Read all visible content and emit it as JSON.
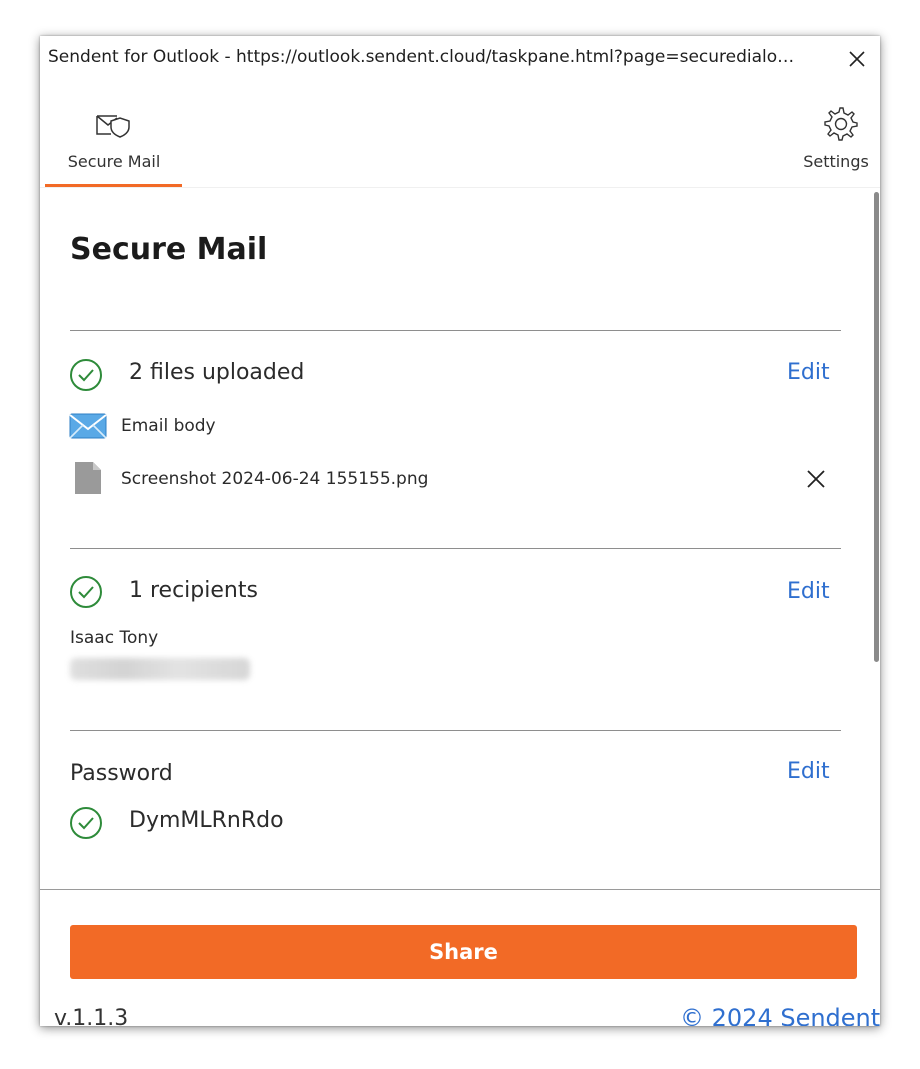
{
  "window": {
    "title": "Sendent for Outlook - https://outlook.sendent.cloud/taskpane.html?page=securedialo…"
  },
  "tabs": {
    "secure_mail": {
      "label": "Secure Mail",
      "icon": "shield-envelope-icon"
    },
    "settings": {
      "label": "Settings",
      "icon": "gear-icon"
    }
  },
  "main": {
    "title": "Secure Mail",
    "files": {
      "status": "2 files uploaded",
      "edit_label": "Edit",
      "items": [
        {
          "name": "Email body",
          "icon": "envelope-icon"
        },
        {
          "name": "Screenshot 2024-06-24 155155.png",
          "icon": "file-icon"
        }
      ]
    },
    "recipients": {
      "status": "1 recipients",
      "edit_label": "Edit",
      "list": [
        {
          "name": "Isaac Tony"
        }
      ]
    },
    "password": {
      "label": "Password",
      "edit_label": "Edit",
      "value": "DymMLRnRdo"
    }
  },
  "footer": {
    "share_label": "Share",
    "version": "v.1.1.3",
    "copyright": "© 2024 Sendent"
  },
  "colors": {
    "accent": "#f26a26",
    "link": "#2f6fcf",
    "success": "#2e8b3a"
  }
}
